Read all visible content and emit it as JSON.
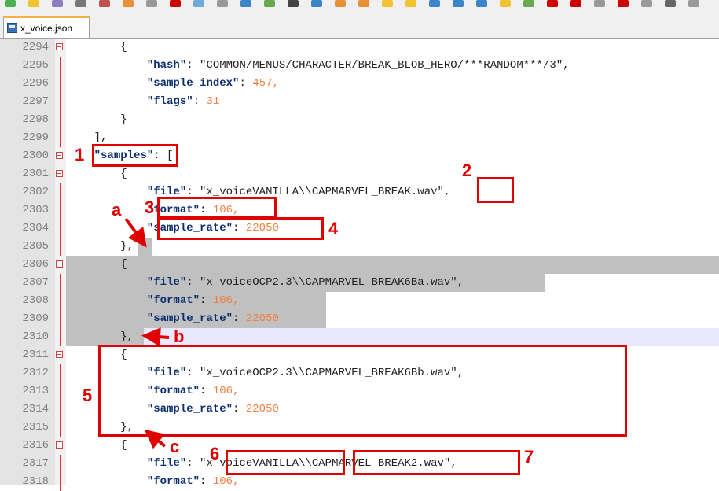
{
  "tab": {
    "filename": "x_voice.json"
  },
  "lines": [
    {
      "n": "2294",
      "segs": [
        {
          "t": "        {",
          "c": "p"
        }
      ]
    },
    {
      "n": "2295",
      "segs": [
        {
          "t": "            ",
          "c": "p"
        },
        {
          "t": "\"hash\"",
          "c": "k"
        },
        {
          "t": ": \"COMMON/MENUS/CHARACTER/BREAK_BLOB_HERO/***RANDOM***/3\",",
          "c": "s"
        }
      ]
    },
    {
      "n": "2296",
      "segs": [
        {
          "t": "            ",
          "c": "p"
        },
        {
          "t": "\"sample_index\"",
          "c": "k"
        },
        {
          "t": ": ",
          "c": "p"
        },
        {
          "t": "457,",
          "c": "n"
        }
      ]
    },
    {
      "n": "2297",
      "segs": [
        {
          "t": "            ",
          "c": "p"
        },
        {
          "t": "\"flags\"",
          "c": "k"
        },
        {
          "t": ": ",
          "c": "p"
        },
        {
          "t": "31",
          "c": "n"
        }
      ]
    },
    {
      "n": "2298",
      "segs": [
        {
          "t": "        }",
          "c": "p"
        }
      ]
    },
    {
      "n": "2299",
      "segs": [
        {
          "t": "    ],",
          "c": "p"
        }
      ]
    },
    {
      "n": "2300",
      "segs": [
        {
          "t": "    ",
          "c": "p"
        },
        {
          "t": "\"samples\"",
          "c": "k"
        },
        {
          "t": ": [",
          "c": "p"
        }
      ]
    },
    {
      "n": "2301",
      "segs": [
        {
          "t": "        {",
          "c": "p"
        }
      ]
    },
    {
      "n": "2302",
      "segs": [
        {
          "t": "            ",
          "c": "p"
        },
        {
          "t": "\"file\"",
          "c": "k"
        },
        {
          "t": ": \"x_voiceVANILLA\\\\CAPMARVEL_BREAK.wav\",",
          "c": "s"
        }
      ]
    },
    {
      "n": "2303",
      "segs": [
        {
          "t": "            ",
          "c": "p"
        },
        {
          "t": "\"format\"",
          "c": "k"
        },
        {
          "t": ": ",
          "c": "p"
        },
        {
          "t": "106,",
          "c": "n"
        }
      ]
    },
    {
      "n": "2304",
      "segs": [
        {
          "t": "            ",
          "c": "p"
        },
        {
          "t": "\"sample_rate\"",
          "c": "k"
        },
        {
          "t": ": ",
          "c": "p"
        },
        {
          "t": "22050",
          "c": "n"
        }
      ]
    },
    {
      "n": "2305",
      "segs": [
        {
          "t": "        },",
          "c": "p"
        }
      ]
    },
    {
      "n": "2306",
      "segs": [
        {
          "t": "        {",
          "c": "p"
        }
      ]
    },
    {
      "n": "2307",
      "segs": [
        {
          "t": "            ",
          "c": "p"
        },
        {
          "t": "\"file\"",
          "c": "k"
        },
        {
          "t": ": \"x_voiceOCP2.3\\\\CAPMARVEL_BREAK6Ba.wav\",",
          "c": "s"
        }
      ]
    },
    {
      "n": "2308",
      "segs": [
        {
          "t": "            ",
          "c": "p"
        },
        {
          "t": "\"format\"",
          "c": "k"
        },
        {
          "t": ": ",
          "c": "p"
        },
        {
          "t": "106,",
          "c": "n"
        }
      ]
    },
    {
      "n": "2309",
      "segs": [
        {
          "t": "            ",
          "c": "p"
        },
        {
          "t": "\"sample_rate\"",
          "c": "k"
        },
        {
          "t": ": ",
          "c": "p"
        },
        {
          "t": "22050",
          "c": "n"
        }
      ]
    },
    {
      "n": "2310",
      "segs": [
        {
          "t": "        },",
          "c": "p"
        }
      ]
    },
    {
      "n": "2311",
      "segs": [
        {
          "t": "        {",
          "c": "p"
        }
      ]
    },
    {
      "n": "2312",
      "segs": [
        {
          "t": "            ",
          "c": "p"
        },
        {
          "t": "\"file\"",
          "c": "k"
        },
        {
          "t": ": \"x_voiceOCP2.3\\\\CAPMARVEL_BREAK6Bb.wav\",",
          "c": "s"
        }
      ]
    },
    {
      "n": "2313",
      "segs": [
        {
          "t": "            ",
          "c": "p"
        },
        {
          "t": "\"format\"",
          "c": "k"
        },
        {
          "t": ": ",
          "c": "p"
        },
        {
          "t": "106,",
          "c": "n"
        }
      ]
    },
    {
      "n": "2314",
      "segs": [
        {
          "t": "            ",
          "c": "p"
        },
        {
          "t": "\"sample_rate\"",
          "c": "k"
        },
        {
          "t": ": ",
          "c": "p"
        },
        {
          "t": "22050",
          "c": "n"
        }
      ]
    },
    {
      "n": "2315",
      "segs": [
        {
          "t": "        },",
          "c": "p"
        }
      ]
    },
    {
      "n": "2316",
      "segs": [
        {
          "t": "        {",
          "c": "p"
        }
      ]
    },
    {
      "n": "2317",
      "segs": [
        {
          "t": "            ",
          "c": "p"
        },
        {
          "t": "\"file\"",
          "c": "k"
        },
        {
          "t": ": \"x_voiceVANILLA\\\\CAPMARVEL_BREAK2.wav\",",
          "c": "s"
        }
      ]
    },
    {
      "n": "2318",
      "segs": [
        {
          "t": "            ",
          "c": "p"
        },
        {
          "t": "\"format\"",
          "c": "k"
        },
        {
          "t": ": ",
          "c": "p"
        },
        {
          "t": "106,",
          "c": "n"
        }
      ]
    }
  ],
  "fold_lines": [
    "2294",
    "2300",
    "2301",
    "2306",
    "2311",
    "2316"
  ],
  "annotations": {
    "labels": [
      "1",
      "2",
      "3",
      "4",
      "5",
      "6",
      "7",
      "a",
      "b",
      "c"
    ]
  },
  "colors": {
    "annotation": "#e00000",
    "key": "#0b2e6f",
    "number": "#f08040",
    "selection": "#c0c0c0"
  }
}
